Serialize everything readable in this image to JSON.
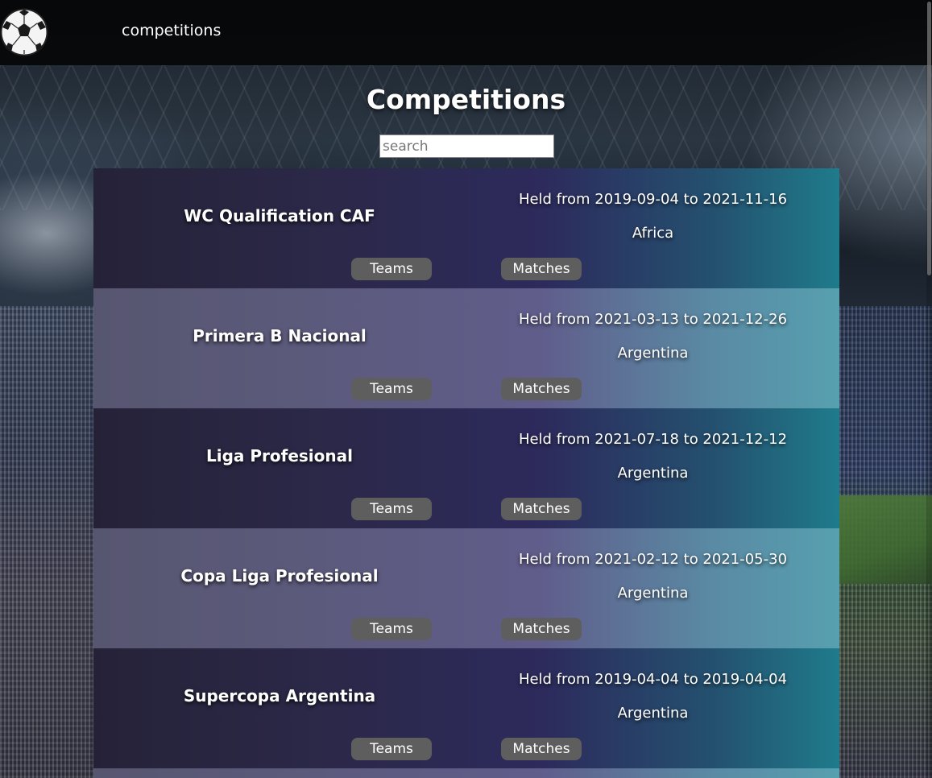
{
  "nav": {
    "link_label": "competitions"
  },
  "header": {
    "title": "Competitions"
  },
  "search": {
    "placeholder": "search",
    "value": ""
  },
  "competitions": [
    {
      "name": "WC Qualification CAF",
      "dates": "Held from 2019-09-04 to 2021-11-16",
      "region": "Africa",
      "teams_label": "Teams",
      "matches_label": "Matches"
    },
    {
      "name": "Primera B Nacional",
      "dates": "Held from 2021-03-13 to 2021-12-26",
      "region": "Argentina",
      "teams_label": "Teams",
      "matches_label": "Matches"
    },
    {
      "name": "Liga Profesional",
      "dates": "Held from 2021-07-18 to 2021-12-12",
      "region": "Argentina",
      "teams_label": "Teams",
      "matches_label": "Matches"
    },
    {
      "name": "Copa Liga Profesional",
      "dates": "Held from 2021-02-12 to 2021-05-30",
      "region": "Argentina",
      "teams_label": "Teams",
      "matches_label": "Matches"
    },
    {
      "name": "Supercopa Argentina",
      "dates": "Held from 2019-04-04 to 2019-04-04",
      "region": "Argentina",
      "teams_label": "Teams",
      "matches_label": "Matches"
    }
  ],
  "theme": {
    "card_dark": "#2b2848",
    "card_light": "#5c5a7c",
    "accent_teal": "#1f7b8b",
    "button_bg": "#5e5e5e"
  }
}
